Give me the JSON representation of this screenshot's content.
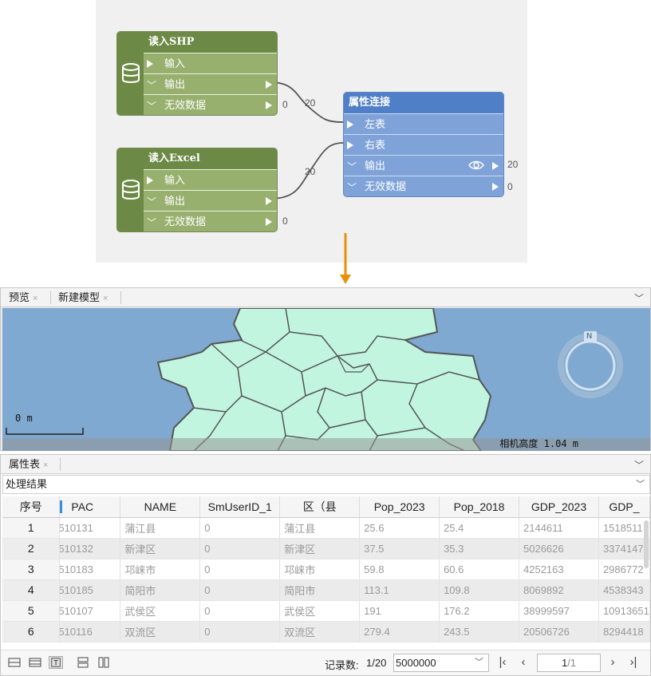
{
  "workflow": {
    "read_shp": {
      "title": "读入SHP",
      "ports": [
        {
          "label": "输入",
          "kind": "input"
        },
        {
          "label": "输出",
          "kind": "output"
        },
        {
          "label": "无效数据",
          "kind": "output",
          "count": "0"
        }
      ],
      "edge_count": "20"
    },
    "read_excel": {
      "title": "读入Excel",
      "ports": [
        {
          "label": "输入",
          "kind": "input"
        },
        {
          "label": "输出",
          "kind": "output"
        },
        {
          "label": "无效数据",
          "kind": "output",
          "count": "0"
        }
      ],
      "edge_count": "20"
    },
    "attr_join": {
      "title": "属性连接",
      "ports": [
        {
          "label": "左表",
          "kind": "input"
        },
        {
          "label": "右表",
          "kind": "input"
        },
        {
          "label": "输出",
          "kind": "output",
          "count": "20"
        },
        {
          "label": "无效数据",
          "kind": "output",
          "count": "0"
        }
      ]
    },
    "colors": {
      "node_green": "#98b06e",
      "node_green_dark": "#6c8a46",
      "node_blue": "#7fa3d9",
      "node_blue_title": "#4f7fc6",
      "arrow": "#e8900a"
    }
  },
  "preview": {
    "tabs": [
      {
        "label": "预览",
        "close": "×"
      },
      {
        "label": "新建模型",
        "close": "×"
      }
    ],
    "scale_label": "0 m",
    "camera_label": "相机高度 1.04 m",
    "compass_label": "N",
    "colors": {
      "sea": "#7fa9d1",
      "land": "#c1f5df",
      "border": "#555555"
    }
  },
  "attribute_table": {
    "tab": {
      "label": "属性表",
      "close": "×"
    },
    "source": "处理结果",
    "columns": [
      "序号",
      "PAC",
      "NAME",
      "SmUserID_1",
      "区（县",
      "Pop_2023",
      "Pop_2018",
      "GDP_2023",
      "GDP_"
    ],
    "rows": [
      {
        "idx": "1",
        "pac": "510131",
        "name": "蒲江县",
        "smuserid": "0",
        "district": "蒲江县",
        "pop2023": "25.6",
        "pop2018": "25.4",
        "gdp2023": "2144611",
        "gdp2018": "1518511"
      },
      {
        "idx": "2",
        "pac": "510132",
        "name": "新津区",
        "smuserid": "0",
        "district": "新津区",
        "pop2023": "37.5",
        "pop2018": "35.3",
        "gdp2023": "5026626",
        "gdp2018": "3374147"
      },
      {
        "idx": "3",
        "pac": "510183",
        "name": "邛崃市",
        "smuserid": "0",
        "district": "邛崃市",
        "pop2023": "59.8",
        "pop2018": "60.6",
        "gdp2023": "4252163",
        "gdp2018": "2986772"
      },
      {
        "idx": "4",
        "pac": "510185",
        "name": "简阳市",
        "smuserid": "0",
        "district": "简阳市",
        "pop2023": "113.1",
        "pop2018": "109.8",
        "gdp2023": "8069892",
        "gdp2018": "4538343"
      },
      {
        "idx": "5",
        "pac": "510107",
        "name": "武侯区",
        "smuserid": "0",
        "district": "武侯区",
        "pop2023": "191",
        "pop2018": "176.2",
        "gdp2023": "38999597",
        "gdp2018": "10913651"
      },
      {
        "idx": "6",
        "pac": "510116",
        "name": "双流区",
        "smuserid": "0",
        "district": "双流区",
        "pop2023": "279.4",
        "pop2018": "243.5",
        "gdp2023": "20506726",
        "gdp2018": "8294418"
      }
    ],
    "footer": {
      "record_label": "记录数:",
      "record_count": "1/20",
      "page_size": "5000000",
      "page_current": "1",
      "page_total": "/1",
      "nav": {
        "first": "|‹",
        "prev": "‹",
        "next": "›",
        "last": "›|"
      }
    }
  }
}
